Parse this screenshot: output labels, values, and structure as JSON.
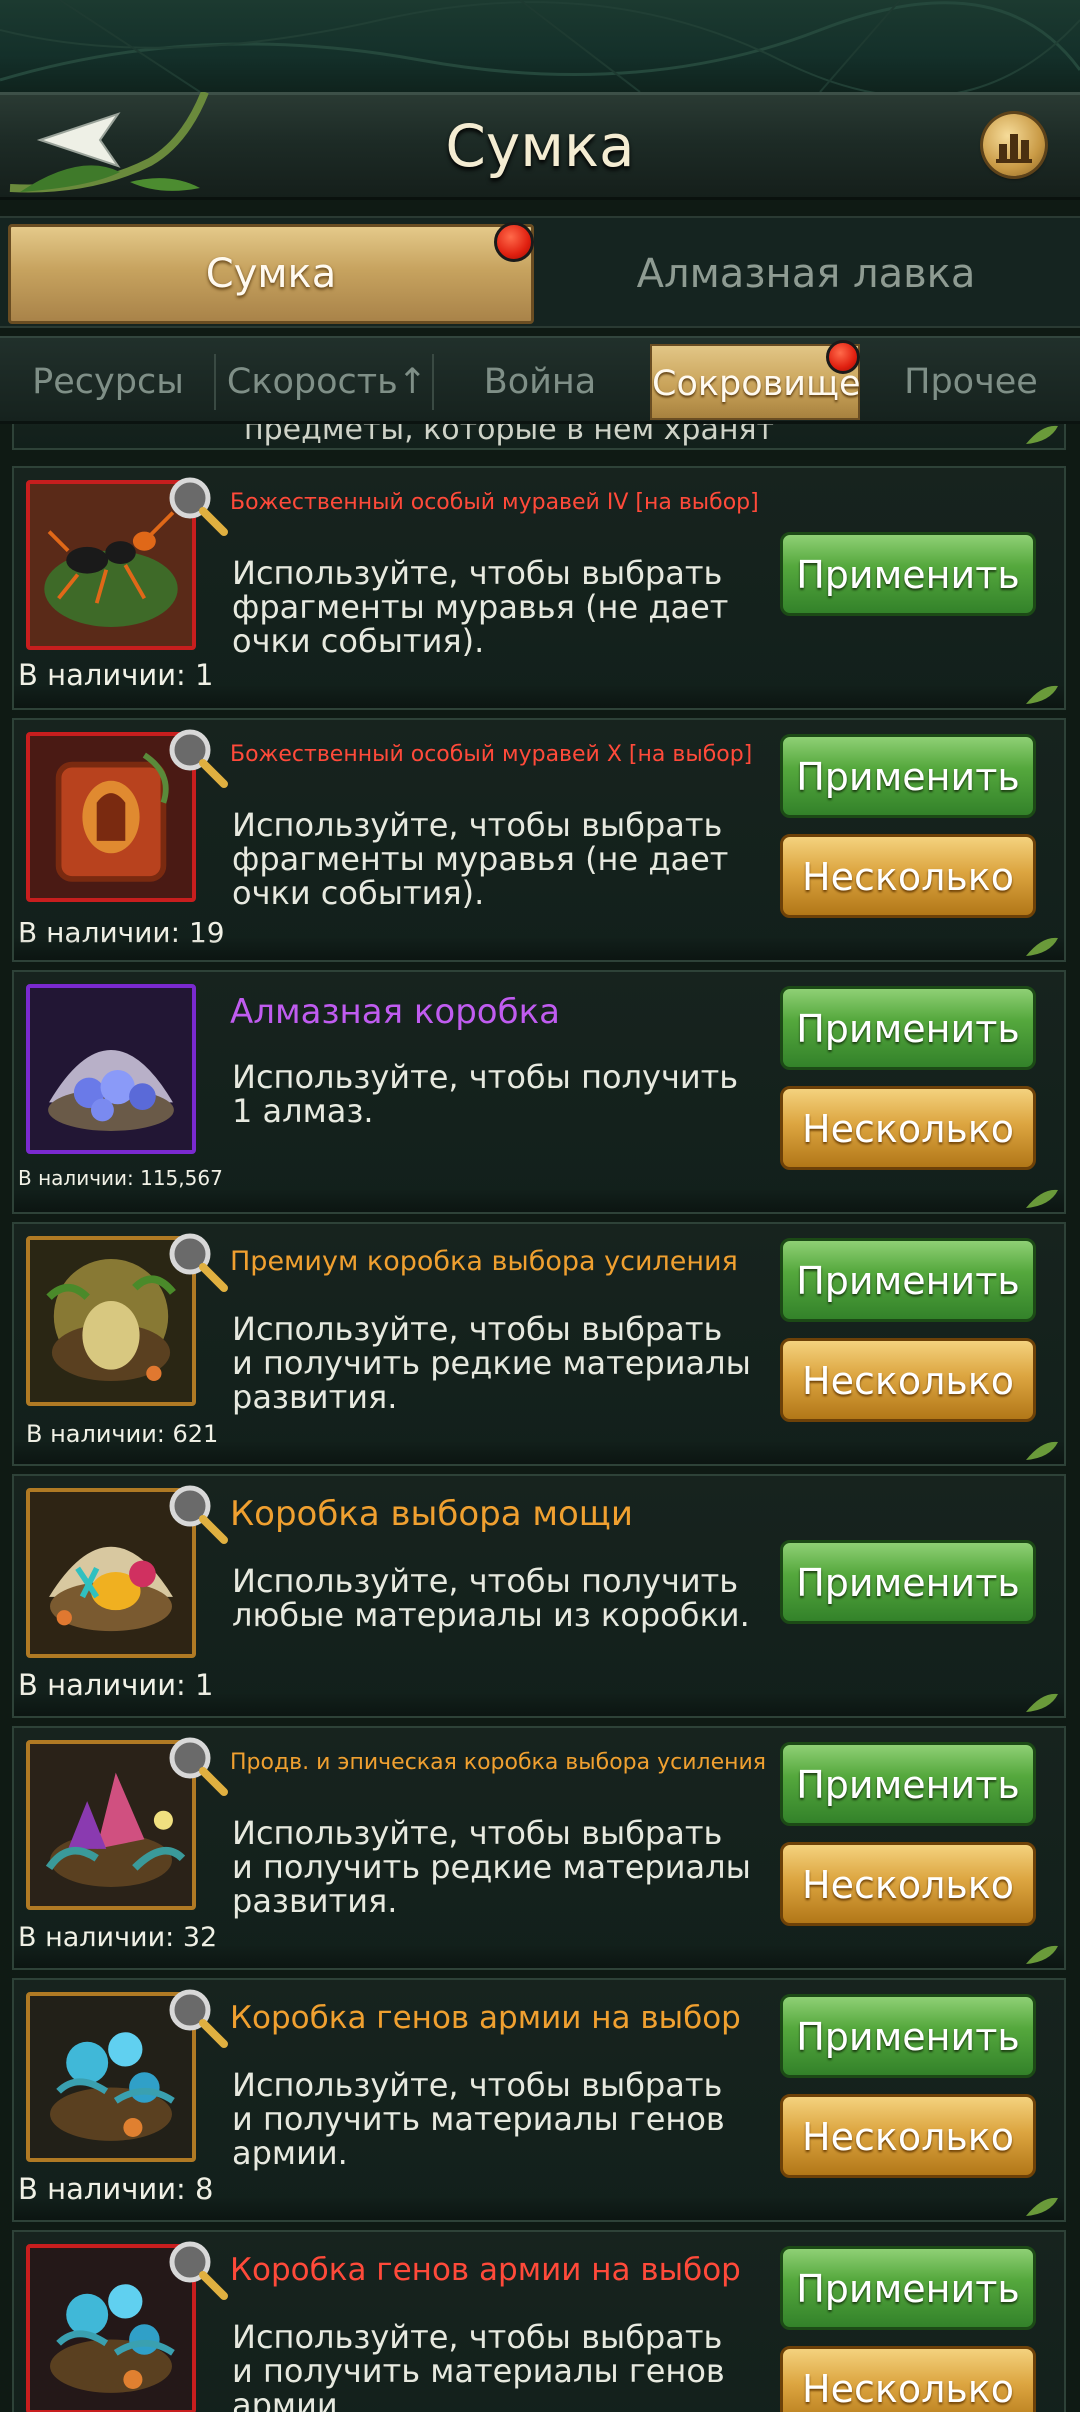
{
  "header": {
    "title": "Сумка"
  },
  "main_tabs": [
    {
      "label": "Сумка",
      "active": true,
      "badge": true
    },
    {
      "label": "Алмазная лавка",
      "active": false,
      "badge": false
    }
  ],
  "sub_tabs": [
    {
      "label": "Ресурсы",
      "active": false
    },
    {
      "label": "Скорость↑",
      "active": false
    },
    {
      "label": "Война",
      "active": false
    },
    {
      "label": "Сокровище",
      "active": true,
      "badge": true
    },
    {
      "label": "Прочее",
      "active": false
    }
  ],
  "partial_text": "предметы, которые в нем хранят",
  "items": [
    {
      "name": "Божественный особый муравей IV [на выбор]",
      "name_color": "#ff4a3a",
      "desc": "Используйте, чтобы выбрать фрагменты муравья (не дает очки события).",
      "count": "В наличии: 1",
      "apply": "Применить",
      "multiple": null,
      "icon": "red-ant-icon"
    },
    {
      "name": "Божественный особый муравей X [на выбор]",
      "name_color": "#ff4a3a",
      "desc": "Используйте, чтобы выбрать фрагменты муравья (не дает очки события).",
      "count": "В наличии: 19",
      "apply": "Применить",
      "multiple": "Несколько",
      "icon": "red-shield-icon"
    },
    {
      "name": "Алмазная коробка",
      "name_color": "#c05cf0",
      "desc": "Используйте, чтобы получить 1 алмаз.",
      "count": "В наличии: 115,567",
      "apply": "Применить",
      "multiple": "Несколько",
      "icon": "diamond-shell-icon"
    },
    {
      "name": "Премиум коробка выбора усиления",
      "name_color": "#f0a030",
      "desc": "Используйте, чтобы выбрать и получить редкие материалы развития.",
      "count": "В наличии: 621",
      "apply": "Применить",
      "multiple": "Несколько",
      "icon": "premium-nest-icon"
    },
    {
      "name": "Коробка выбора мощи",
      "name_color": "#f0a030",
      "desc": "Используйте, чтобы получить любые материалы из коробки.",
      "count": "В наличии: 1",
      "apply": "Применить",
      "multiple": null,
      "icon": "power-shell-icon"
    },
    {
      "name": "Продв. и эпическая коробка выбора усиления",
      "name_color": "#f0a030",
      "desc": "Используйте, чтобы выбрать и получить редкие материалы развития.",
      "count": "В наличии: 32",
      "apply": "Применить",
      "multiple": "Несколько",
      "icon": "crystal-nest-icon"
    },
    {
      "name": "Коробка генов армии на выбор",
      "name_color": "#f0a030",
      "desc": "Используйте, чтобы выбрать и получить материалы генов армии.",
      "count": "В наличии: 8",
      "apply": "Применить",
      "multiple": "Несколько",
      "icon": "gene-nest-icon"
    },
    {
      "name": "Коробка генов армии на выбор",
      "name_color": "#ff4a3a",
      "desc": "Используйте, чтобы выбрать и получить материалы генов армии.",
      "count": "",
      "apply": "Применить",
      "multiple": "Несколько",
      "icon": "gene-nest-red-icon"
    }
  ]
}
